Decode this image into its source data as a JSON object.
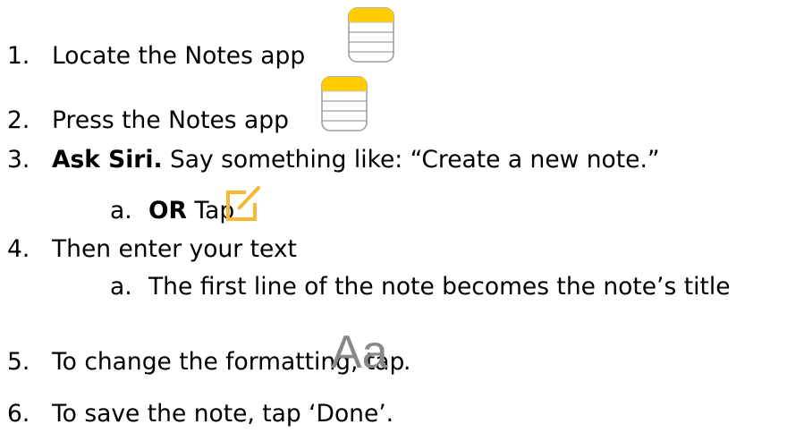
{
  "steps": [
    {
      "num": "1.",
      "text": "Locate the Notes app"
    },
    {
      "num": "2.",
      "text": "Press the Notes app"
    },
    {
      "num": "3.",
      "bold": "Ask Siri.",
      "text": " Say something like: “Create a new note.”"
    },
    {
      "num": "4.",
      "text": "Then enter your text"
    },
    {
      "num": "5.",
      "text": "To change the formatting, tap",
      "after": "."
    },
    {
      "num": "6.",
      "text": "To save the note, tap ‘Done’."
    }
  ],
  "substeps": {
    "step3a": {
      "letter": "a.",
      "bold": "OR",
      "text": " Tap"
    },
    "step4a": {
      "letter": "a.",
      "text": "The first line of the note becomes the note’s title"
    }
  },
  "icons": {
    "notes": "notes-app-icon",
    "compose": "compose-icon",
    "format": "Aa"
  },
  "colors": {
    "notes_yellow": "#FFCC00",
    "compose_yellow": "#F7B731",
    "format_gray": "#888888"
  }
}
